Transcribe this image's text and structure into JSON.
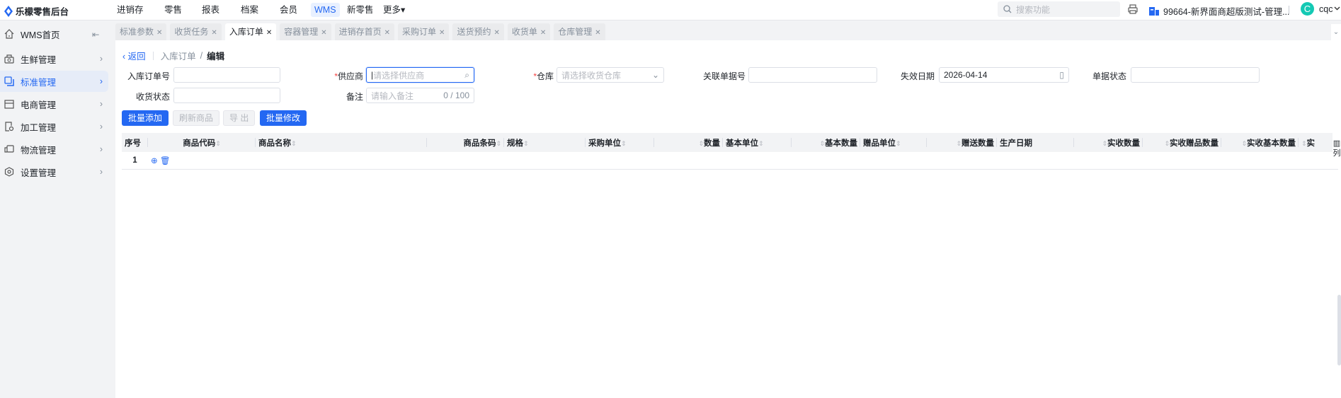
{
  "app": {
    "title": "乐檬零售后台"
  },
  "topnav": [
    {
      "label": "进销存"
    },
    {
      "label": "零售"
    },
    {
      "label": "报表"
    },
    {
      "label": "档案"
    },
    {
      "label": "会员"
    },
    {
      "label": "WMS",
      "active": true
    },
    {
      "label": "新零售"
    },
    {
      "label": "更多▾"
    }
  ],
  "header": {
    "search_placeholder": "搜索功能",
    "shop": "99664-新界面商超版测试-管理...",
    "avatar_letter": "C",
    "user": "cqc"
  },
  "sidebar": {
    "items": [
      {
        "label": "WMS首页",
        "icon": "home-icon"
      },
      {
        "label": "生鲜管理",
        "icon": "basket-icon"
      },
      {
        "label": "标准管理",
        "icon": "copy-icon",
        "active": true
      },
      {
        "label": "电商管理",
        "icon": "store-icon"
      },
      {
        "label": "加工管理",
        "icon": "process-icon"
      },
      {
        "label": "物流管理",
        "icon": "truck-icon"
      },
      {
        "label": "设置管理",
        "icon": "settings-icon"
      }
    ]
  },
  "tabs": [
    {
      "label": "标准参数"
    },
    {
      "label": "收货任务"
    },
    {
      "label": "入库订单",
      "active": true
    },
    {
      "label": "容器管理"
    },
    {
      "label": "进销存首页"
    },
    {
      "label": "采购订单"
    },
    {
      "label": "送货预约"
    },
    {
      "label": "收货单"
    },
    {
      "label": "仓库管理"
    }
  ],
  "breadcrumb": {
    "back": "返回",
    "parent": "入库订单",
    "slash": "/",
    "current": "编辑"
  },
  "form": {
    "order_no": {
      "label": "入库订单号",
      "value": ""
    },
    "supplier": {
      "label": "供应商",
      "required": "*",
      "placeholder": "请选择供应商"
    },
    "warehouse": {
      "label": "仓库",
      "required": "*",
      "placeholder": "请选择收货仓库"
    },
    "related_no": {
      "label": "关联单据号",
      "value": ""
    },
    "expire_date": {
      "label": "失效日期",
      "value": "2026-04-14"
    },
    "doc_status": {
      "label": "单据状态",
      "value": ""
    },
    "receive_status": {
      "label": "收货状态",
      "value": ""
    },
    "remark": {
      "label": "备注",
      "placeholder": "请输入备注",
      "counter": "0 / 100"
    }
  },
  "buttons": {
    "batch_add": "批量添加",
    "refresh": "刷新商品",
    "export": "导 出",
    "batch_edit": "批量修改"
  },
  "table": {
    "columns": [
      "序号",
      "商品代码",
      "商品名称",
      "商品条码",
      "规格",
      "采购单位",
      "数量",
      "基本单位",
      "基本数量",
      "赠品单位",
      "赠送数量",
      "生产日期",
      "实收数量",
      "实收赠品数量",
      "实收基本数量",
      "实"
    ],
    "rows": [
      {
        "index": "1"
      }
    ],
    "column_settings": "列"
  }
}
